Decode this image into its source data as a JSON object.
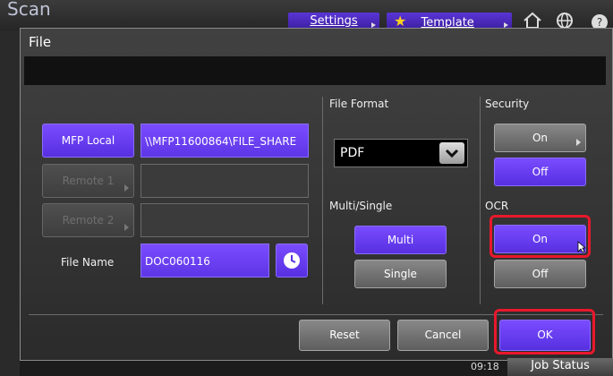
{
  "app": {
    "title": "Scan"
  },
  "topbar": {
    "settings_label": "Settings",
    "template_label": "Template",
    "home_icon": "home-icon",
    "globe_icon": "globe-icon",
    "help_icon": "help-icon"
  },
  "dialog": {
    "title": "File",
    "destinations": {
      "mfp_local_label": "MFP Local",
      "mfp_local_path": "\\\\MFP11600864\\FILE_SHARE",
      "remote1_label": "Remote 1",
      "remote2_label": "Remote 2",
      "file_name_label": "File Name",
      "file_name_value": "DOC060116"
    },
    "file_format": {
      "label": "File Format",
      "selected": "PDF"
    },
    "multi_single": {
      "label": "Multi/Single",
      "multi_label": "Multi",
      "single_label": "Single",
      "selected": "Multi"
    },
    "security": {
      "label": "Security",
      "on_label": "On",
      "off_label": "Off",
      "selected": "Off"
    },
    "ocr": {
      "label": "OCR",
      "on_label": "On",
      "off_label": "Off",
      "selected": "On"
    },
    "buttons": {
      "reset": "Reset",
      "cancel": "Cancel",
      "ok": "OK"
    }
  },
  "statusbar": {
    "time": "09:18",
    "job_status_label": "Job Status"
  },
  "colors": {
    "accent_purple": "#6a3df0",
    "highlight_red": "#e8182c",
    "background": "#333333"
  }
}
